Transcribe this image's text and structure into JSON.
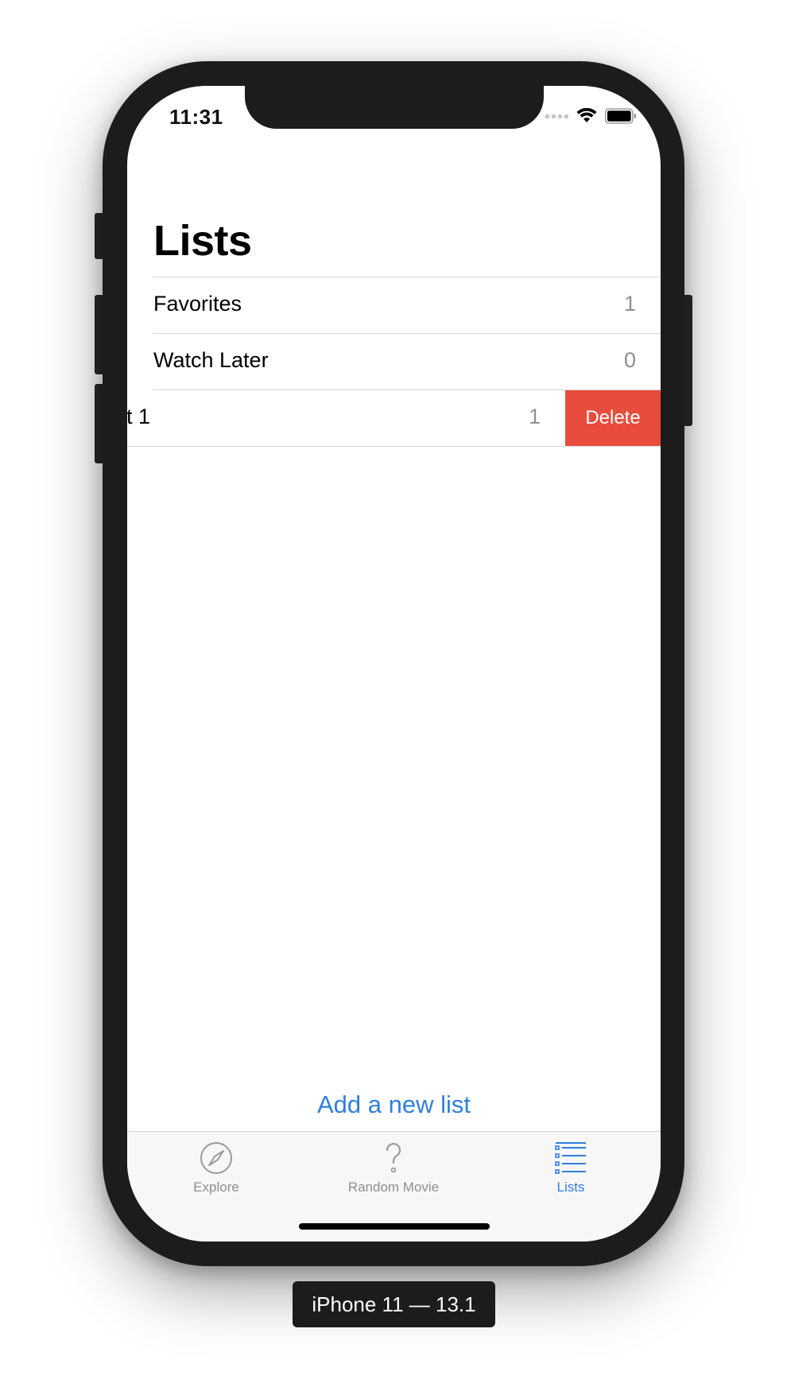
{
  "status_bar": {
    "time": "11:31"
  },
  "page": {
    "title": "Lists"
  },
  "lists": [
    {
      "name": "Favorites",
      "count": "1"
    },
    {
      "name": "Watch Later",
      "count": "0"
    },
    {
      "name": "t 1",
      "count": "1",
      "swipe_action": "Delete"
    }
  ],
  "add_list_label": "Add a new list",
  "tab_bar": {
    "tabs": [
      {
        "label": "Explore",
        "icon": "compass-icon"
      },
      {
        "label": "Random Movie",
        "icon": "question-mark-icon"
      },
      {
        "label": "Lists",
        "icon": "list-icon",
        "active": true
      }
    ]
  },
  "device_label": "iPhone 11 — 13.1",
  "colors": {
    "accent": "#2f7fe0",
    "destructive": "#e74c3c",
    "secondary_text": "#8e8e93"
  }
}
